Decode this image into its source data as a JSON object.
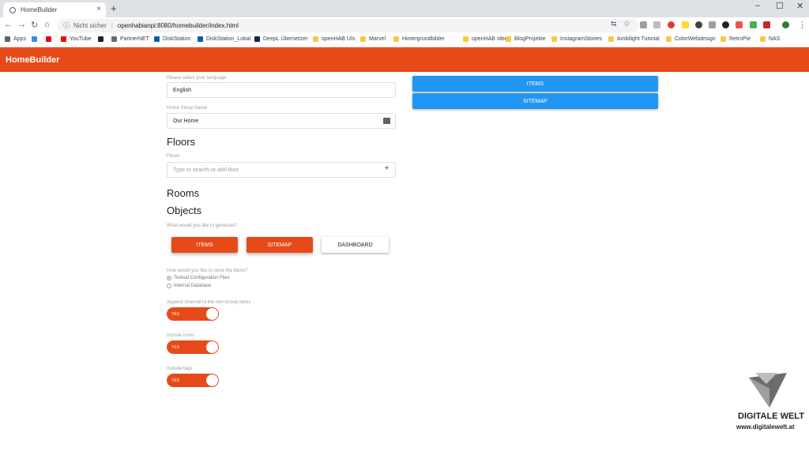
{
  "browser": {
    "tab_title": "HomeBuilder",
    "tab_close": "×",
    "new_tab": "+",
    "security_label": "Nicht sicher",
    "url": "openhabianpi:8080/homebuilder/index.html",
    "window_controls": [
      "–",
      "☐",
      "✕"
    ]
  },
  "bookmarks": [
    {
      "label": "Apps",
      "color": "#5f6368"
    },
    {
      "label": "",
      "color": "#4285f4"
    },
    {
      "label": "",
      "color": "#e60023"
    },
    {
      "label": "YouTube",
      "color": "#ff0000"
    },
    {
      "label": "",
      "color": "#222222"
    },
    {
      "label": "PartnerNET",
      "color": "#6b6b6b"
    },
    {
      "label": "DiskStation",
      "color": "#0a5fa8"
    },
    {
      "label": "DiskStation_Lokal",
      "color": "#0a5fa8"
    },
    {
      "label": "DeepL Übersetzer",
      "color": "#0f2b46"
    },
    {
      "label": "openHAB UIs",
      "color": "#f7c948"
    },
    {
      "label": "Marvel",
      "color": "#f7c948"
    },
    {
      "label": "Hintergrundbilder",
      "color": "#f7c948"
    },
    {
      "label": "openHAB Ideen",
      "color": "#f7c948"
    },
    {
      "label": "BlogProjekte",
      "color": "#f7c948"
    },
    {
      "label": "InstagramStories",
      "color": "#f7c948"
    },
    {
      "label": "Ambilight Tutorial",
      "color": "#f7c948"
    },
    {
      "label": "ColorWebdesign",
      "color": "#f7c948"
    },
    {
      "label": "RetroPie",
      "color": "#f7c948"
    },
    {
      "label": "NAS",
      "color": "#f7c948"
    }
  ],
  "app": {
    "title": "HomeBuilder",
    "accent": "#e64a19",
    "blue": "#2196f3"
  },
  "form": {
    "language_label": "Please select your language",
    "language_value": "English",
    "setup_name_label": "Home Setup Name",
    "setup_name_value": "Our Home",
    "floors_heading": "Floors",
    "floors_label": "Floors",
    "floors_placeholder": "Type to search or add floor",
    "rooms_heading": "Rooms",
    "objects_heading": "Objects",
    "generate_label": "What would you like to generate?",
    "generate_buttons": [
      "ITEMS",
      "SITEMAP",
      "DASHBOARD"
    ],
    "store_label": "How would you like to store the items?",
    "store_options": [
      "Textual Configuration Files",
      "Internal Database"
    ],
    "toggles": [
      {
        "label": "Append channel to the non-Group items",
        "value": "YES"
      },
      {
        "label": "Include icons",
        "value": "YES"
      },
      {
        "label": "Include tags",
        "value": "YES"
      }
    ]
  },
  "preview": {
    "tabs": [
      "ITEMS",
      "SITEMAP"
    ]
  },
  "watermark": {
    "brand": "DIGITALE WELT",
    "url": "www.digitalewelt.at"
  }
}
